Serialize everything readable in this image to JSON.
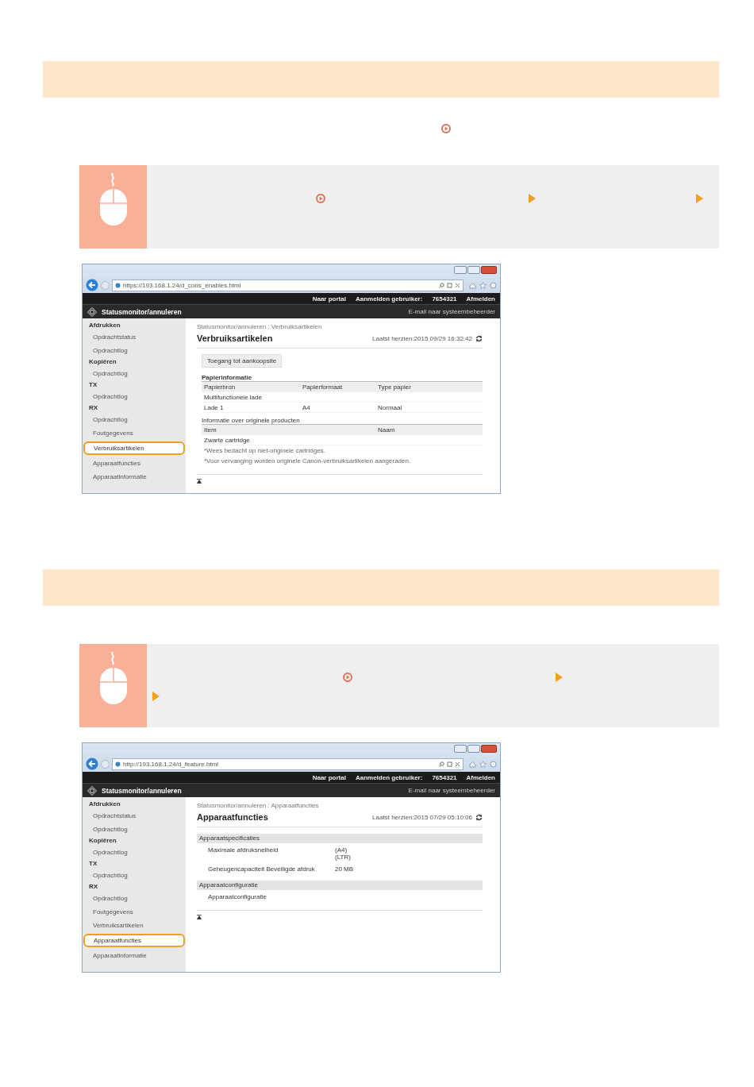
{
  "sections": [
    {
      "intro_icons": [
        {
          "kind": "link"
        }
      ],
      "step": {
        "lines": [
          [
            {
              "kind": "link"
            },
            {
              "kind": "arrow"
            },
            {
              "kind": "arrow"
            }
          ]
        ]
      },
      "browser": {
        "url": "https://193.168.1.24/d_cons_enables.html",
        "top_links": [
          "Naar portal",
          "Aanmelden gebruiker:",
          "7654321",
          "Afmelden"
        ],
        "app_title": "Statusmonitor/annuleren",
        "email_link": "E-mail naar systeembeheerder",
        "menu": [
          {
            "group": "Afdrukken",
            "items": [
              {
                "label": "Opdrachtstatus",
                "selected": false
              },
              {
                "label": "Opdrachtlog",
                "selected": false
              }
            ]
          },
          {
            "group": "Kopiëren",
            "items": [
              {
                "label": "Opdrachtlog",
                "selected": false
              }
            ]
          },
          {
            "group": "TX",
            "items": [
              {
                "label": "Opdrachtlog",
                "selected": false
              }
            ]
          },
          {
            "group": "RX",
            "items": [
              {
                "label": "Opdrachtlog",
                "selected": false
              },
              {
                "label": "Foutgegevens",
                "selected": false
              },
              {
                "label": "Verbruiksartikelen",
                "selected": true
              },
              {
                "label": "Apparaatfuncties",
                "selected": false
              },
              {
                "label": "Apparaatinformatie",
                "selected": false
              }
            ]
          }
        ],
        "breadcrumb": "Statusmonitor/annuleren : Verbruiksartikelen",
        "page_title": "Verbruiksartikelen",
        "last_updated": "Laatst herzien:2015 09/29 16:32:42",
        "content": [
          {
            "kind": "button",
            "label": "Toegang tot aankoopsite"
          },
          {
            "kind": "table",
            "title": "Papierinformatie",
            "columns": [
              "Papierbron",
              "Papierformaat",
              "Type papier"
            ],
            "rows": [
              [
                "Multifunctionele lade"
              ],
              [
                "Lade 1",
                "A4",
                "Normaal"
              ]
            ]
          },
          {
            "kind": "table",
            "title": "Informatie over originele producten",
            "columns": [
              "Item",
              "Naam"
            ],
            "rows": [
              [
                "Zwarte cartridge"
              ]
            ]
          },
          {
            "kind": "note",
            "text": "*Wees bedacht op niet-originele cartridges."
          },
          {
            "kind": "note",
            "text": "*Voor vervanging worden originele Canon-verbruiksartikelen aangeraden."
          }
        ]
      }
    },
    {
      "step": {
        "lines": [
          [
            {
              "kind": "link"
            },
            {
              "kind": "arrow"
            }
          ],
          [
            {
              "kind": "arrow"
            }
          ]
        ]
      },
      "browser": {
        "url": "http://193.168.1.24/d_feature.html",
        "top_links": [
          "Naar portal",
          "Aanmelden gebruiker:",
          "7654321",
          "Afmelden"
        ],
        "app_title": "Statusmonitor/annuleren",
        "email_link": "E-mail naar systeembeheerder",
        "menu": [
          {
            "group": "Afdrukken",
            "items": [
              {
                "label": "Opdrachtstatus",
                "selected": false
              },
              {
                "label": "Opdrachtlog",
                "selected": false
              }
            ]
          },
          {
            "group": "Kopiëren",
            "items": [
              {
                "label": "Opdrachtlog",
                "selected": false
              }
            ]
          },
          {
            "group": "TX",
            "items": [
              {
                "label": "Opdrachtlog",
                "selected": false
              }
            ]
          },
          {
            "group": "RX",
            "items": [
              {
                "label": "Opdrachtlog",
                "selected": false
              },
              {
                "label": "Foutgegevens",
                "selected": false
              },
              {
                "label": "Verbruiksartikelen",
                "selected": false
              },
              {
                "label": "Apparaatfuncties",
                "selected": true
              },
              {
                "label": "Apparaatinformatie",
                "selected": false
              }
            ]
          }
        ],
        "breadcrumb": "Statusmonitor/annuleren : Apparaatfuncties",
        "page_title": "Apparaatfuncties",
        "last_updated": "Laatst herzien:2015 07/29 05:10:06",
        "content": [
          {
            "kind": "spec_group",
            "title": "Apparaatspecificaties",
            "rows": [
              {
                "label": "Maximale afdruksnelheid",
                "values": [
                  "(A4)",
                  "(LTR)"
                ]
              },
              {
                "label": "Geheugencapaciteit Beveiligde afdruk",
                "values": [
                  "20 MB"
                ]
              }
            ]
          },
          {
            "kind": "spec_group",
            "title": "Apparaatconfiguratie",
            "rows": [
              {
                "label": "Apparaatconfiguratie",
                "values": []
              }
            ]
          }
        ]
      }
    }
  ]
}
